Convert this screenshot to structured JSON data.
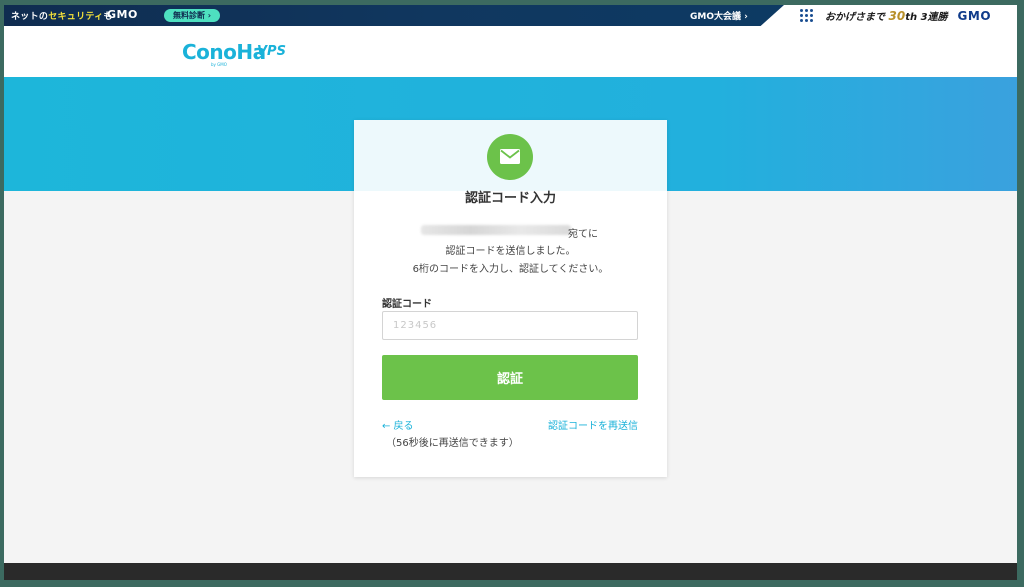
{
  "gmo_bar": {
    "tagline_prefix": "ネットの",
    "tagline_highlight": "セキュリティ",
    "tagline_suffix": "も",
    "logo_left": "GMO",
    "pill": "無料診断 ›",
    "meeting": "GMO大会議 ›",
    "anniv_prefix": "おかげさまで",
    "anniv_number": "30",
    "anniv_suffix": "th 3連勝",
    "logo_right": "GMO"
  },
  "header": {
    "logo": "ConoHa",
    "logo_sub": "by GMO",
    "product": "VPS"
  },
  "card": {
    "title": "認証コード入力",
    "msg_line1": "宛てに",
    "msg_line2": "認証コードを送信しました。",
    "msg_line3": "6桁のコードを入力し、認証してください。",
    "field_label": "認証コード",
    "input_placeholder": "123456",
    "input_value": "",
    "submit_label": "認証",
    "back_label": "← 戻る",
    "resend_label": "認証コードを再送信",
    "resend_note": "（56秒後に再送信できます）"
  },
  "colors": {
    "accent_blue": "#1ab2d9",
    "accent_green": "#6cc24a",
    "gmo_navy": "#0f2c50"
  },
  "icons": {
    "mail": "mail-icon",
    "grid": "grid-icon"
  }
}
